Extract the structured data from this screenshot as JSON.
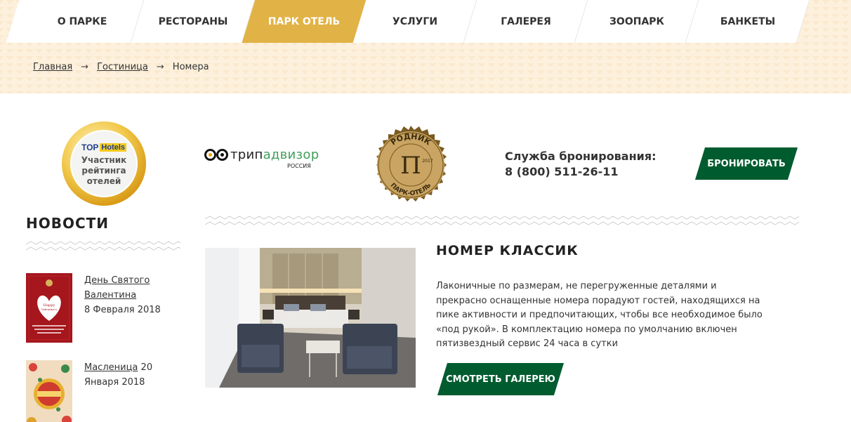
{
  "nav": {
    "items": [
      "О ПАРКЕ",
      "РЕСТОРАНЫ",
      "ПАРК ОТЕЛЬ",
      "УСЛУГИ",
      "ГАЛЕРЕЯ",
      "ЗООПАРК",
      "БАНКЕТЫ"
    ],
    "active_index": 2
  },
  "breadcrumb": {
    "home": "Главная",
    "section": "Гостиница",
    "current": "Номера",
    "separator": "→"
  },
  "badges": {
    "top_hotels": {
      "logo_top": "TOP",
      "logo_hotels": "Hotels",
      "text": [
        "Участник",
        "рейтинга",
        "отелей"
      ]
    },
    "tripadvisor": {
      "word_prefix": "трип",
      "word_suffix": "адвизор",
      "country": "РОССИЯ"
    },
    "rodnik": {
      "top": "РОДНИК",
      "bottom": "ПАРК-ОТЕЛЬ",
      "year": "2017"
    }
  },
  "booking": {
    "label": "Служба бронирования:",
    "phone": "8 (800) 511-26-11",
    "button": "БРОНИРОВАТЬ"
  },
  "news": {
    "title": "НОВОСТИ",
    "items": [
      {
        "title": "День Святого Валентина",
        "date": "8 Февраля 2018"
      },
      {
        "title": "Масленица",
        "date": "20 Января 2018"
      }
    ]
  },
  "room": {
    "title": "НОМЕР КЛАССИК",
    "description": "Лаконичные по размерам, не перегруженные деталями и прекрасно оснащенные номера порадуют гостей, находящихся на пике активности и предпочитающих, чтобы все необходимое было «под рукой». В комплектацию номера по умолчанию включен пятизвездный сервис 24 часа в сутки",
    "gallery_button": "СМОТРЕТЬ ГАЛЕРЕЮ"
  },
  "colors": {
    "accent_gold": "#e1b245",
    "button_green": "#005c2f",
    "band_bg": "#fdf1de"
  }
}
